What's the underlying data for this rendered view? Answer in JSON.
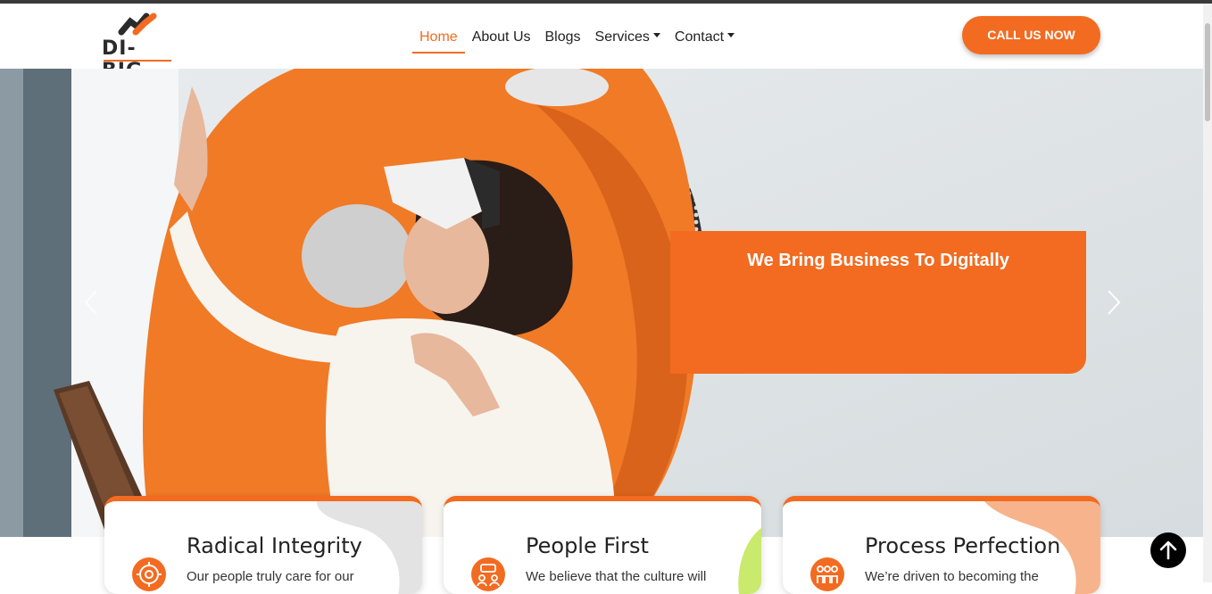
{
  "brand": {
    "name": "DI-BIG",
    "accent": "#f26b21"
  },
  "nav": {
    "items": [
      {
        "label": "Home",
        "active": true,
        "dropdown": false
      },
      {
        "label": "About Us",
        "active": false,
        "dropdown": false
      },
      {
        "label": "Blogs",
        "active": false,
        "dropdown": false
      },
      {
        "label": "Services",
        "active": false,
        "dropdown": true
      },
      {
        "label": "Contact",
        "active": false,
        "dropdown": true
      }
    ]
  },
  "header": {
    "cta_label": "CALL US NOW"
  },
  "hero": {
    "caption": "We Bring Business To Digitally",
    "prev_icon": "chevron-left-icon",
    "next_icon": "chevron-right-icon"
  },
  "cards": [
    {
      "title": "Radical Integrity",
      "text": "Our people truly care for our",
      "icon": "gear-icon"
    },
    {
      "title": "People First",
      "text": "We believe that the culture will",
      "icon": "team-icon"
    },
    {
      "title": "Process Perfection",
      "text": "We’re driven to becoming the",
      "icon": "group-icon"
    }
  ],
  "back_to_top_icon": "arrow-up-icon"
}
